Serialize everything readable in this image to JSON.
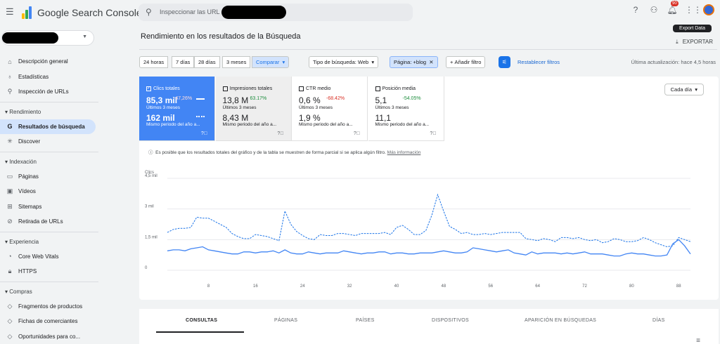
{
  "app": {
    "title": "Google Search Console"
  },
  "search": {
    "placeholder": "Inspeccionar las URL d"
  },
  "notifications": {
    "count": "90"
  },
  "export_data": "Export Data",
  "exportar": "EXPORTAR",
  "page_title": "Rendimiento en los resultados de la Búsqueda",
  "sidebar": {
    "items": [
      {
        "label": "Descripción general",
        "icon": "home-icon"
      },
      {
        "label": "Estadísticas",
        "icon": "lightbulb-icon"
      },
      {
        "label": "Inspección de URLs",
        "icon": "search-icon"
      }
    ],
    "sections": [
      {
        "title": "Rendimiento",
        "items": [
          {
            "label": "Resultados de búsqueda",
            "icon": "google-g-icon",
            "active": true
          },
          {
            "label": "Discover",
            "icon": "asterisk-icon"
          }
        ]
      },
      {
        "title": "Indexación",
        "items": [
          {
            "label": "Páginas",
            "icon": "pages-icon"
          },
          {
            "label": "Vídeos",
            "icon": "video-icon"
          },
          {
            "label": "Sitemaps",
            "icon": "sitemap-icon"
          },
          {
            "label": "Retirada de URLs",
            "icon": "eye-off-icon"
          }
        ]
      },
      {
        "title": "Experiencia",
        "items": [
          {
            "label": "Core Web Vitals",
            "icon": "gauge-icon"
          },
          {
            "label": "HTTPS",
            "icon": "lock-icon"
          }
        ]
      },
      {
        "title": "Compras",
        "items": [
          {
            "label": "Fragmentos de productos",
            "icon": "diamond-icon"
          },
          {
            "label": "Fichas de comerciantes",
            "icon": "diamond-icon"
          },
          {
            "label": "Oportunidades para co...",
            "icon": "diamond-icon"
          }
        ]
      }
    ]
  },
  "filters": {
    "ranges": [
      "24 horas",
      "7 días",
      "28 días",
      "3 meses"
    ],
    "compare": "Comparar",
    "search_type": "Tipo de búsqueda: Web",
    "page_filter": "Página: +blog",
    "add_filter": "Añadir filtro",
    "reset": "Restablecer filtros",
    "last_update": "Última actualización: hace 4,5 horas"
  },
  "metrics": [
    {
      "label": "Clics totales",
      "value": "85,3 mil",
      "delta": "-47,26%",
      "period": "Últimos 3 meses",
      "prev_value": "162 mil",
      "prev_period": "Mismo periodo del año a..."
    },
    {
      "label": "Impresiones totales",
      "value": "13,8 M",
      "delta": "63.17%",
      "period": "Últimos 3 meses",
      "prev_value": "8,43 M",
      "prev_period": "Mismo periodo del año a..."
    },
    {
      "label": "CTR medio",
      "value": "0,6 %",
      "delta": "-68.42%",
      "period": "Últimos 3 meses",
      "prev_value": "1,9 %",
      "prev_period": "Mismo periodo del año a..."
    },
    {
      "label": "Posición media",
      "value": "5,1",
      "delta": "-54.05%",
      "period": "Últimos 3 meses",
      "prev_value": "11,1",
      "prev_period": "Mismo periodo del año a..."
    }
  ],
  "granularity": "Cada día",
  "info": {
    "text": "Es posible que los resultados totales del gráfico y de la tabla se muestren de forma parcial si se aplica algún filtro.",
    "link": "Más información"
  },
  "chart_data": {
    "type": "line",
    "ylabel": "Clics",
    "yticks": [
      "4,5 mil",
      "3 mil",
      "1,5 mil",
      "0"
    ],
    "ylim": [
      0,
      4500
    ],
    "xticks": [
      8,
      16,
      24,
      32,
      40,
      48,
      56,
      64,
      72,
      80,
      88
    ],
    "xlim": [
      1,
      90
    ],
    "colors": {
      "current": "#4285f4",
      "previous": "#1a73e8"
    },
    "series": [
      {
        "style": "solid",
        "values": [
          950,
          1000,
          1000,
          950,
          1050,
          1100,
          1150,
          1000,
          950,
          900,
          850,
          800,
          800,
          900,
          900,
          850,
          900,
          900,
          950,
          850,
          1000,
          850,
          800,
          800,
          900,
          850,
          800,
          850,
          850,
          850,
          950,
          900,
          850,
          800,
          850,
          850,
          900,
          900,
          800,
          850,
          850,
          800,
          800,
          850,
          850,
          850,
          900,
          950,
          900,
          850,
          850,
          900,
          1100,
          1050,
          1000,
          950,
          900,
          950,
          1000,
          850,
          800,
          750,
          900,
          800,
          850,
          850,
          850,
          800,
          850,
          800,
          850,
          900,
          800,
          800,
          800,
          750,
          700,
          700,
          800,
          850,
          800,
          800,
          750,
          700,
          700,
          750,
          1300,
          1500,
          1200,
          800
        ]
      },
      {
        "style": "dashed",
        "values": [
          1850,
          2000,
          2050,
          2050,
          2100,
          2600,
          2550,
          2550,
          2400,
          2250,
          2100,
          1800,
          1650,
          1550,
          1550,
          1750,
          1700,
          1650,
          1550,
          1450,
          2900,
          2250,
          1900,
          1700,
          1550,
          1500,
          1750,
          1700,
          1700,
          1800,
          1800,
          1750,
          1700,
          1800,
          1800,
          1800,
          1800,
          1850,
          1750,
          2100,
          2200,
          2000,
          1750,
          1750,
          1950,
          2700,
          3700,
          2900,
          2150,
          2000,
          1800,
          1850,
          1750,
          1750,
          1800,
          1750,
          1800,
          1850,
          1850,
          1850,
          1850,
          1550,
          1500,
          1450,
          1550,
          1500,
          1400,
          1600,
          1600,
          1550,
          1600,
          1500,
          1450,
          1500,
          1350,
          1400,
          1550,
          1500,
          1400,
          1400,
          1450,
          1600,
          1500,
          1350,
          1250,
          1150,
          1200,
          1600,
          1500,
          1400
        ]
      }
    ]
  },
  "tabs": [
    "CONSULTAS",
    "PÁGINAS",
    "PAÍSES",
    "DISPOSITIVOS",
    "APARICIÓN EN BÚSQUEDAS",
    "DÍAS"
  ]
}
